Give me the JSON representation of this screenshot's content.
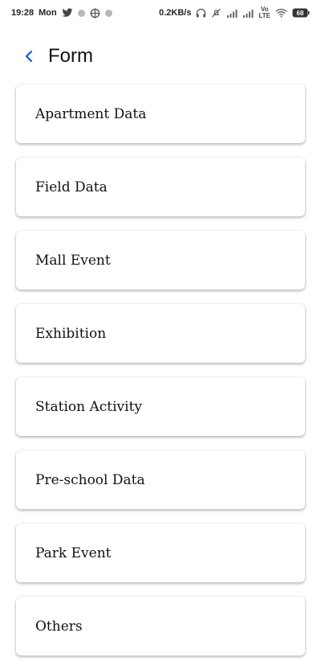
{
  "status_bar": {
    "time": "19:28",
    "day": "Mon",
    "network_speed": "0.2KB/s",
    "battery_level": "68",
    "volte_top": "Vo",
    "volte_bottom": "LTE",
    "icons": [
      "twitter-icon",
      "circle-icon",
      "crosshair-icon",
      "circle-icon",
      "headphones-icon",
      "mute-icon",
      "signal-icon",
      "signal-icon",
      "volte-icon",
      "wifi-icon",
      "battery-icon"
    ]
  },
  "header": {
    "title": "Form",
    "back_icon": "chevron-left-icon",
    "accent_color": "#1a55d6"
  },
  "items": [
    {
      "label": "Apartment Data"
    },
    {
      "label": "Field Data"
    },
    {
      "label": "Mall Event"
    },
    {
      "label": "Exhibition"
    },
    {
      "label": "Station Activity"
    },
    {
      "label": "Pre-school Data"
    },
    {
      "label": "Park Event"
    },
    {
      "label": "Others"
    }
  ]
}
